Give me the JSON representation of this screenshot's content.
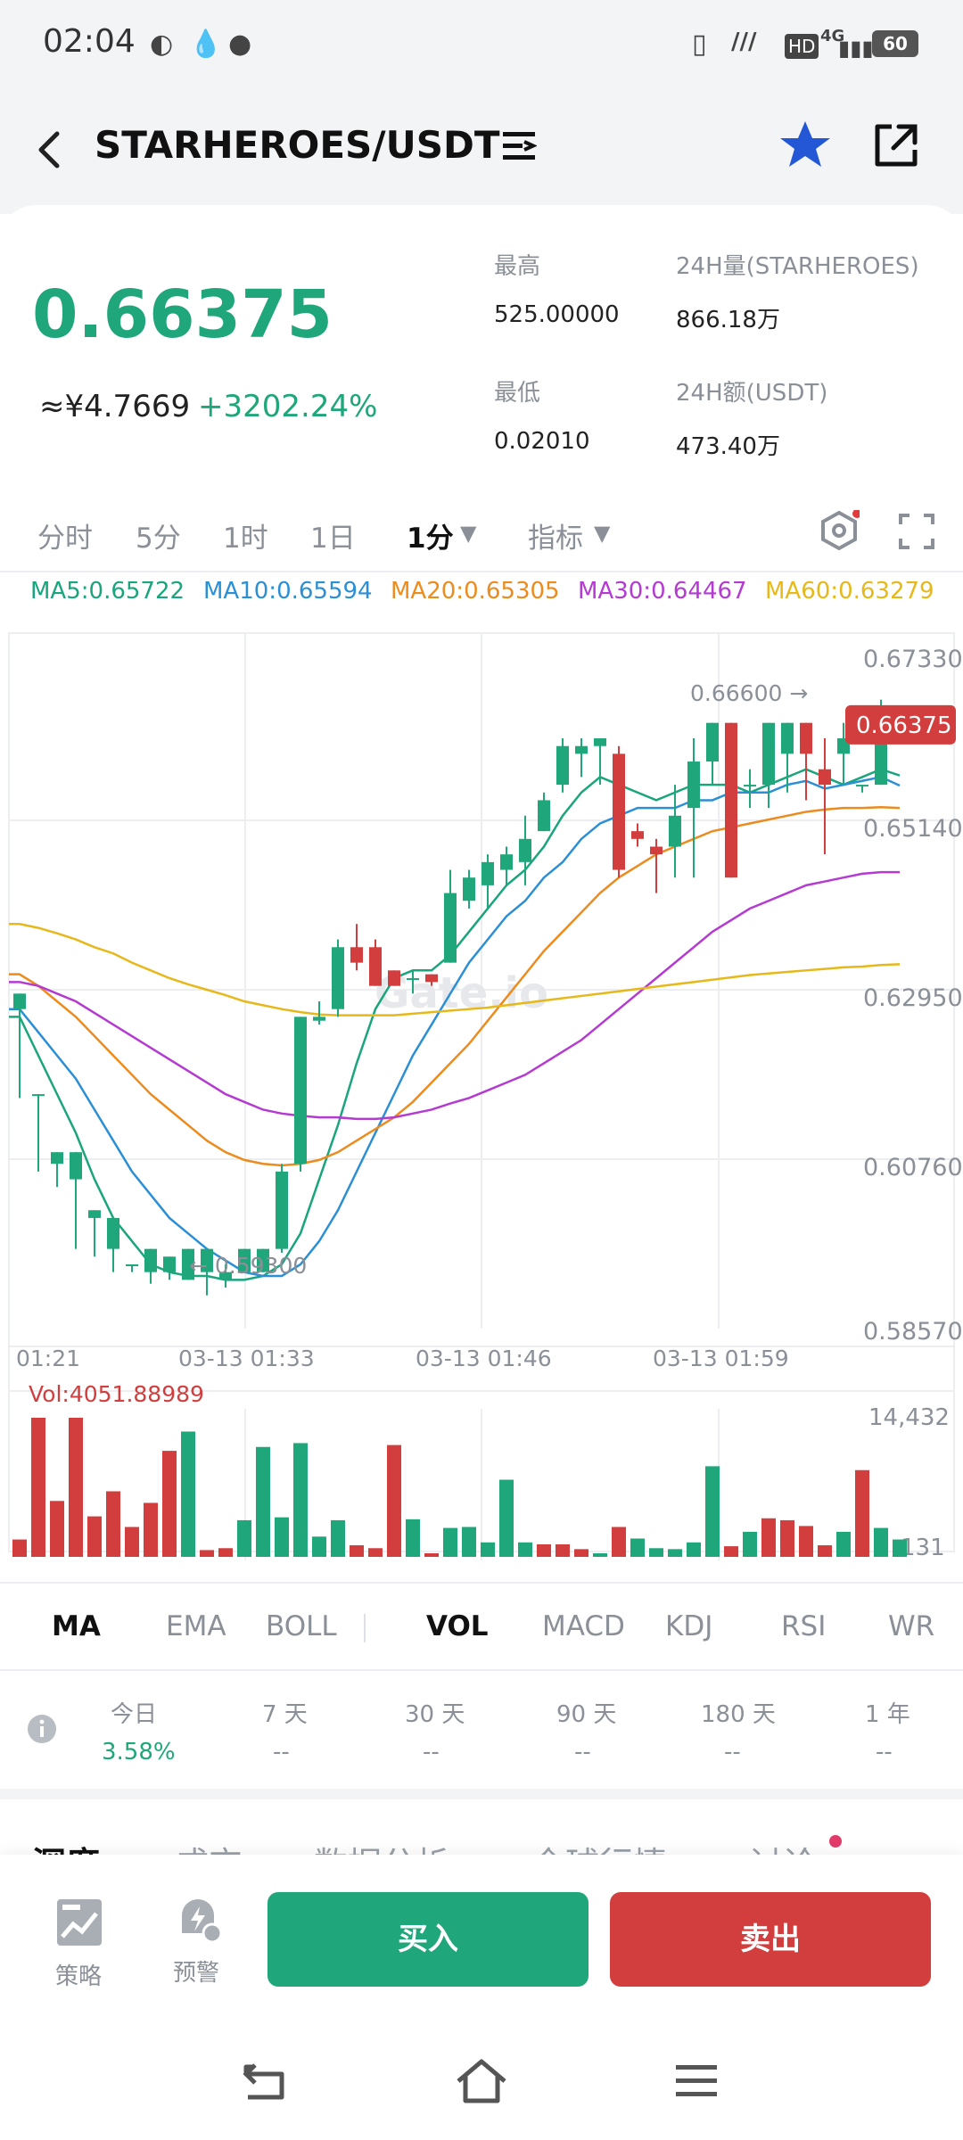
{
  "status_bar": {
    "time": "02:04",
    "battery": "60",
    "network": "4G"
  },
  "header": {
    "title": "STARHEROES/USDT"
  },
  "ticker": {
    "price": "0.66375",
    "cny": "≈¥4.7669",
    "change": "+3202.24%",
    "high_label": "最高",
    "high_value": "525.00000",
    "vol_label": "24H量(STARHEROES)",
    "vol_value": "866.18万",
    "low_label": "最低",
    "low_value": "0.02010",
    "amount_label": "24H额(USDT)",
    "amount_value": "473.40万"
  },
  "timeframes": {
    "items": [
      "分时",
      "5分",
      "1时",
      "1日"
    ],
    "active": "1分",
    "indicator": "指标"
  },
  "ma_legend": [
    {
      "label": "MA5:0.65722",
      "color": "#1aa57d"
    },
    {
      "label": "MA10:0.65594",
      "color": "#2b8fd6"
    },
    {
      "label": "MA20:0.65305",
      "color": "#ec8b1e"
    },
    {
      "label": "MA30:0.64467",
      "color": "#b43ad2"
    },
    {
      "label": "MA60:0.63279",
      "color": "#e6b81a"
    }
  ],
  "chart_data": {
    "type": "candlestick",
    "y_ticks": [
      "0.67330",
      "0.65140",
      "0.62950",
      "0.60760",
      "0.58570"
    ],
    "ylim": [
      0.5857,
      0.6733
    ],
    "x_ticks": [
      "01:21",
      "03-13 01:33",
      "03-13 01:46",
      "03-13 01:59"
    ],
    "last_price_tag": "0.66375",
    "high_marker": "0.66600 →",
    "low_marker": "← 0.59300",
    "watermark": "Gate.io",
    "up_color": "#1fa67a",
    "down_color": "#d23d3d",
    "candles": [
      [
        0.627,
        0.629,
        0.616,
        0.6155
      ],
      [
        0.616,
        0.616,
        0.607,
        0.606
      ],
      [
        0.607,
        0.6085,
        0.605,
        0.604
      ],
      [
        0.605,
        0.6085,
        0.596,
        0.596
      ],
      [
        0.6,
        0.601,
        0.596,
        0.595
      ],
      [
        0.596,
        0.6,
        0.593,
        0.593
      ],
      [
        0.594,
        0.594,
        0.594,
        0.593
      ],
      [
        0.593,
        0.596,
        0.593,
        0.5915
      ],
      [
        0.593,
        0.595,
        0.593,
        0.592
      ],
      [
        0.592,
        0.596,
        0.593,
        0.593
      ],
      [
        0.593,
        0.596,
        0.592,
        0.59
      ],
      [
        0.592,
        0.593,
        0.594,
        0.591
      ],
      [
        0.593,
        0.596,
        0.593,
        0.593
      ],
      [
        0.593,
        0.596,
        0.596,
        0.593
      ],
      [
        0.596,
        0.606,
        0.607,
        0.5955
      ],
      [
        0.607,
        0.626,
        0.626,
        0.606
      ],
      [
        0.6255,
        0.626,
        0.628,
        0.625
      ],
      [
        0.627,
        0.635,
        0.636,
        0.626
      ],
      [
        0.635,
        0.633,
        0.638,
        0.632
      ],
      [
        0.635,
        0.63,
        0.636,
        0.63
      ],
      [
        0.632,
        0.63,
        0.632,
        0.63
      ],
      [
        0.631,
        0.631,
        0.632,
        0.629
      ],
      [
        0.6315,
        0.6305,
        0.6315,
        0.63
      ],
      [
        0.633,
        0.642,
        0.645,
        0.633
      ],
      [
        0.641,
        0.644,
        0.645,
        0.64
      ],
      [
        0.643,
        0.646,
        0.647,
        0.64
      ],
      [
        0.645,
        0.647,
        0.648,
        0.643
      ],
      [
        0.646,
        0.649,
        0.652,
        0.643
      ],
      [
        0.65,
        0.654,
        0.655,
        0.65
      ],
      [
        0.656,
        0.661,
        0.662,
        0.655
      ],
      [
        0.66,
        0.661,
        0.662,
        0.657
      ],
      [
        0.661,
        0.662,
        0.662,
        0.656
      ],
      [
        0.66,
        0.645,
        0.661,
        0.644
      ],
      [
        0.65,
        0.649,
        0.651,
        0.648
      ],
      [
        0.648,
        0.647,
        0.649,
        0.642
      ],
      [
        0.648,
        0.652,
        0.656,
        0.644
      ],
      [
        0.653,
        0.659,
        0.662,
        0.644
      ],
      [
        0.659,
        0.664,
        0.664,
        0.656
      ],
      [
        0.664,
        0.644,
        0.664,
        0.644
      ],
      [
        0.656,
        0.656,
        0.658,
        0.653
      ],
      [
        0.656,
        0.664,
        0.664,
        0.653
      ],
      [
        0.66,
        0.664,
        0.664,
        0.655
      ],
      [
        0.664,
        0.66,
        0.664,
        0.654
      ],
      [
        0.658,
        0.656,
        0.662,
        0.647
      ],
      [
        0.66,
        0.662,
        0.664,
        0.656
      ],
      [
        0.656,
        0.656,
        0.656,
        0.655
      ],
      [
        0.656,
        0.664,
        0.667,
        0.656
      ],
      [
        0.664,
        0.6637,
        0.666,
        0.663
      ]
    ],
    "ma_lines": {
      "MA5": [
        0.626,
        0.621,
        0.616,
        0.611,
        0.605,
        0.6,
        0.597,
        0.594,
        0.593,
        0.5925,
        0.5925,
        0.592,
        0.592,
        0.5925,
        0.594,
        0.598,
        0.605,
        0.612,
        0.62,
        0.627,
        0.631,
        0.632,
        0.632,
        0.634,
        0.637,
        0.64,
        0.643,
        0.645,
        0.648,
        0.652,
        0.655,
        0.657,
        0.656,
        0.655,
        0.654,
        0.655,
        0.656,
        0.656,
        0.656,
        0.655,
        0.656,
        0.657,
        0.658,
        0.657,
        0.656,
        0.657,
        0.658,
        0.6572
      ],
      "MA10": [
        0.627,
        0.624,
        0.621,
        0.618,
        0.614,
        0.61,
        0.606,
        0.603,
        0.6,
        0.598,
        0.596,
        0.5945,
        0.593,
        0.5925,
        0.5925,
        0.594,
        0.597,
        0.601,
        0.606,
        0.611,
        0.616,
        0.621,
        0.625,
        0.629,
        0.633,
        0.636,
        0.639,
        0.641,
        0.644,
        0.646,
        0.649,
        0.651,
        0.652,
        0.653,
        0.653,
        0.653,
        0.654,
        0.654,
        0.655,
        0.655,
        0.655,
        0.656,
        0.6565,
        0.6555,
        0.656,
        0.6565,
        0.657,
        0.6559
      ],
      "MA20": [
        0.6315,
        0.63,
        0.628,
        0.626,
        0.6235,
        0.621,
        0.6185,
        0.616,
        0.614,
        0.612,
        0.61,
        0.6085,
        0.6075,
        0.607,
        0.6068,
        0.607,
        0.6075,
        0.6085,
        0.61,
        0.6115,
        0.613,
        0.615,
        0.6175,
        0.62,
        0.6225,
        0.6255,
        0.6285,
        0.6315,
        0.6345,
        0.637,
        0.6395,
        0.642,
        0.644,
        0.6455,
        0.647,
        0.648,
        0.649,
        0.65,
        0.6505,
        0.651,
        0.6515,
        0.652,
        0.6525,
        0.6528,
        0.653,
        0.653,
        0.6531,
        0.653
      ],
      "MA30": [
        0.6305,
        0.63,
        0.629,
        0.628,
        0.6265,
        0.625,
        0.6235,
        0.622,
        0.6205,
        0.619,
        0.6175,
        0.616,
        0.615,
        0.614,
        0.6135,
        0.6132,
        0.613,
        0.613,
        0.6128,
        0.6128,
        0.613,
        0.6135,
        0.614,
        0.6148,
        0.6155,
        0.6165,
        0.6175,
        0.6185,
        0.62,
        0.6215,
        0.623,
        0.625,
        0.627,
        0.629,
        0.631,
        0.633,
        0.635,
        0.637,
        0.6385,
        0.64,
        0.641,
        0.642,
        0.643,
        0.6435,
        0.644,
        0.6445,
        0.6447,
        0.6447
      ],
      "MA60": [
        0.638,
        0.6375,
        0.6368,
        0.636,
        0.635,
        0.6342,
        0.633,
        0.632,
        0.631,
        0.6302,
        0.6295,
        0.6288,
        0.628,
        0.6275,
        0.627,
        0.6266,
        0.6263,
        0.6262,
        0.6262,
        0.6262,
        0.6262,
        0.6264,
        0.6266,
        0.6268,
        0.627,
        0.6272,
        0.6275,
        0.6278,
        0.6281,
        0.6284,
        0.6287,
        0.629,
        0.6293,
        0.6296,
        0.6299,
        0.6302,
        0.6305,
        0.6308,
        0.6311,
        0.6314,
        0.6316,
        0.6318,
        0.632,
        0.6322,
        0.6324,
        0.6325,
        0.6327,
        0.6328
      ]
    },
    "volume": {
      "label": "Vol:4051.88989",
      "max_label": "14,432",
      "min_label": "131",
      "values": [
        1800,
        14432,
        5800,
        14432,
        4200,
        6800,
        3100,
        5600,
        11000,
        13000,
        700,
        900,
        3800,
        11400,
        4100,
        11800,
        2100,
        3800,
        1200,
        900,
        11600,
        3900,
        120,
        3000,
        3100,
        1500,
        8000,
        1500,
        1300,
        1300,
        800,
        131,
        3100,
        1900,
        900,
        800,
        1500,
        9400,
        1100,
        2600,
        4000,
        3800,
        3200,
        1200,
        2600,
        9000,
        3000,
        1800
      ],
      "up": [
        false,
        false,
        false,
        false,
        false,
        false,
        false,
        false,
        false,
        true,
        false,
        false,
        true,
        true,
        true,
        true,
        true,
        true,
        false,
        false,
        false,
        true,
        false,
        true,
        true,
        true,
        true,
        true,
        false,
        false,
        false,
        true,
        false,
        true,
        true,
        true,
        true,
        true,
        false,
        true,
        false,
        false,
        false,
        false,
        true,
        false,
        true,
        true
      ]
    }
  },
  "indicator_tabs": {
    "main": [
      "MA",
      "EMA",
      "BOLL"
    ],
    "sub": [
      "VOL",
      "MACD",
      "KDJ",
      "RSI",
      "WR"
    ],
    "active_main": "MA",
    "active_sub": "VOL"
  },
  "performance": {
    "columns": [
      {
        "label": "今日",
        "value": "3.58%"
      },
      {
        "label": "7 天",
        "value": "--"
      },
      {
        "label": "30 天",
        "value": "--"
      },
      {
        "label": "90 天",
        "value": "--"
      },
      {
        "label": "180 天",
        "value": "--"
      },
      {
        "label": "1 年",
        "value": "--"
      }
    ]
  },
  "content_tabs": [
    "深度",
    "成交",
    "数据分析",
    "全球行情",
    "讨论"
  ],
  "bottom_bar": {
    "strategy": "策略",
    "alert": "预警",
    "buy": "买入",
    "sell": "卖出"
  }
}
